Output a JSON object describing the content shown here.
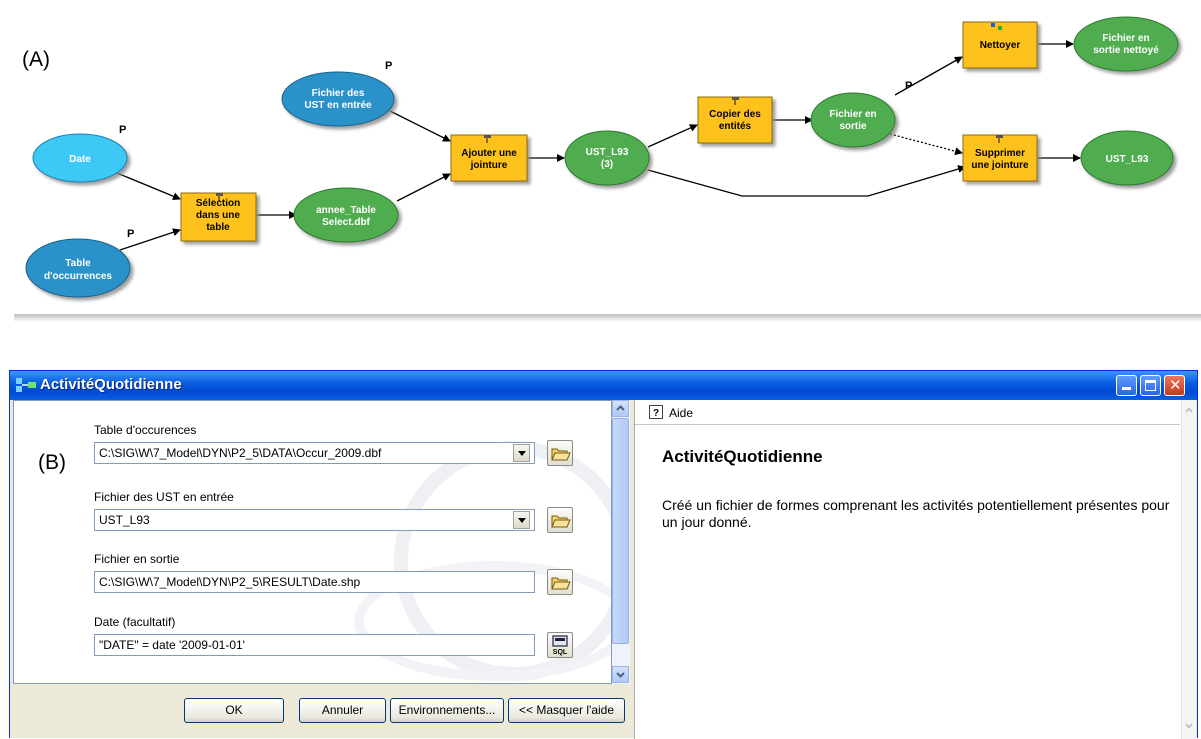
{
  "panel_a": {
    "label": "(A)",
    "nodes": {
      "date": "Date",
      "table_occ_line1": "Table",
      "table_occ_line2": "d'occurrences",
      "selection_line1": "Sélection",
      "selection_line2": "dans une",
      "selection_line3": "table",
      "fichier_ust_line1": "Fichier des",
      "fichier_ust_line2": "UST en entrée",
      "annee_line1": "annee_Table",
      "annee_line2": "Select.dbf",
      "ajouter_line1": "Ajouter une",
      "ajouter_line2": "jointure",
      "ust_l93_3_line1": "UST_L93",
      "ust_l93_3_line2": "(3)",
      "copier_line1": "Copier des",
      "copier_line2": "entités",
      "fichier_sortie_line1": "Fichier en",
      "fichier_sortie_line2": "sortie",
      "nettoyer": "Nettoyer",
      "fichier_nettoye_line1": "Fichier en",
      "fichier_nettoye_line2": "sortie nettoyé",
      "supprimer_line1": "Supprimer",
      "supprimer_line2": "une jointure",
      "ust_l93_out": "UST_L93"
    },
    "param_marker": "P"
  },
  "panel_b": {
    "label": "(B)",
    "window_title": "ActivitéQuotidienne",
    "fields": {
      "table_occ_label": "Table d'occurences",
      "table_occ_value": "C:\\SIG\\W\\7_Model\\DYN\\P2_5\\DATA\\Occur_2009.dbf",
      "ust_input_label": "Fichier des UST en entrée",
      "ust_input_value": "UST_L93",
      "output_label": "Fichier en sortie",
      "output_value": "C:\\SIG\\W\\7_Model\\DYN\\P2_5\\RESULT\\Date.shp",
      "date_label": "Date (facultatif)",
      "date_value": "\"DATE\" = date '2009-01-01'"
    },
    "buttons": {
      "ok": "OK",
      "cancel": "Annuler",
      "environments": "Environnements...",
      "hide_help": "<< Masquer l'aide"
    },
    "help": {
      "header": "Aide",
      "title": "ActivitéQuotidienne",
      "body": "Créé un fichier de formes comprenant les activités potentiellement présentes pour un jour donné."
    },
    "colors": {
      "title_bar": "#0a5fe0",
      "tool_box": "#ffc21e",
      "input_ellipse": "#2a92c9",
      "date_ellipse": "#3ec8f5",
      "derived_ellipse": "#4fad4f"
    }
  }
}
